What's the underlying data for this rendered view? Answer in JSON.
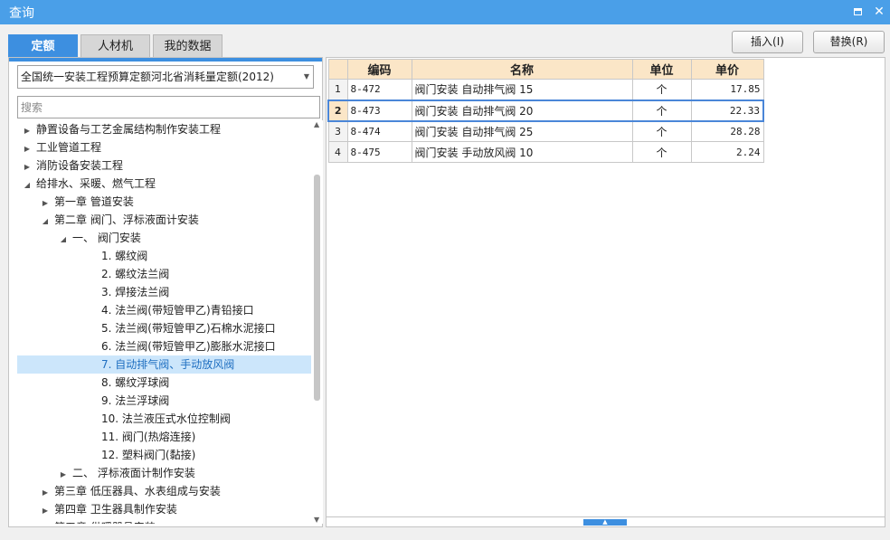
{
  "window": {
    "title": "查询",
    "maximize_icon": "maximize-icon",
    "close_icon": "close-icon",
    "close_glyph": "✕"
  },
  "tabs": [
    {
      "label": "定额",
      "active": true
    },
    {
      "label": "人材机",
      "active": false
    },
    {
      "label": "我的数据",
      "active": false
    }
  ],
  "actions": {
    "insert_label": "插入(I)",
    "replace_label": "替换(R)"
  },
  "quota_select": {
    "value": "全国统一安装工程预算定额河北省消耗量定额(2012)"
  },
  "search": {
    "placeholder": "搜索",
    "value": ""
  },
  "tree": [
    {
      "label": "静置设备与工艺金属结构制作安装工程",
      "level": 0,
      "toggle": "▶",
      "selected": false
    },
    {
      "label": "工业管道工程",
      "level": 0,
      "toggle": "▶",
      "selected": false
    },
    {
      "label": "消防设备安装工程",
      "level": 0,
      "toggle": "▶",
      "selected": false
    },
    {
      "label": "给排水、采暖、燃气工程",
      "level": 0,
      "toggle": "◢",
      "selected": false
    },
    {
      "label": "第一章  管道安装",
      "level": 1,
      "toggle": "▶",
      "selected": false
    },
    {
      "label": "第二章  阀门、浮标液面计安装",
      "level": 1,
      "toggle": "◢",
      "selected": false
    },
    {
      "label": "一、  阀门安装",
      "level": 2,
      "toggle": "◢",
      "selected": false
    },
    {
      "label": "1.  螺纹阀",
      "level": 3,
      "toggle": "",
      "selected": false
    },
    {
      "label": "2.  螺纹法兰阀",
      "level": 3,
      "toggle": "",
      "selected": false
    },
    {
      "label": "3.  焊接法兰阀",
      "level": 3,
      "toggle": "",
      "selected": false
    },
    {
      "label": "4.  法兰阀(带短管甲乙)青铅接口",
      "level": 3,
      "toggle": "",
      "selected": false
    },
    {
      "label": "5.  法兰阀(带短管甲乙)石棉水泥接口",
      "level": 3,
      "toggle": "",
      "selected": false
    },
    {
      "label": "6.  法兰阀(带短管甲乙)膨胀水泥接口",
      "level": 3,
      "toggle": "",
      "selected": false
    },
    {
      "label": "7.  自动排气阀、手动放风阀",
      "level": 3,
      "toggle": "",
      "selected": true
    },
    {
      "label": "8.  螺纹浮球阀",
      "level": 3,
      "toggle": "",
      "selected": false
    },
    {
      "label": "9.  法兰浮球阀",
      "level": 3,
      "toggle": "",
      "selected": false
    },
    {
      "label": "10.  法兰液压式水位控制阀",
      "level": 3,
      "toggle": "",
      "selected": false
    },
    {
      "label": "11.  阀门(热熔连接)",
      "level": 3,
      "toggle": "",
      "selected": false
    },
    {
      "label": "12.  塑料阀门(黏接)",
      "level": 3,
      "toggle": "",
      "selected": false
    },
    {
      "label": "二、  浮标液面计制作安装",
      "level": 2,
      "toggle": "▶",
      "selected": false
    },
    {
      "label": "第三章  低压器具、水表组成与安装",
      "level": 1,
      "toggle": "▶",
      "selected": false
    },
    {
      "label": "第四章  卫生器具制作安装",
      "level": 1,
      "toggle": "▶",
      "selected": false
    },
    {
      "label": "第五章  供暖器具安装",
      "level": 1,
      "toggle": "▶",
      "selected": false
    }
  ],
  "table": {
    "headers": {
      "code": "编码",
      "name": "名称",
      "unit": "单位",
      "price": "单价"
    },
    "rows": [
      {
        "num": "1",
        "code": "8-472",
        "name": "阀门安装 自动排气阀 15",
        "unit": "个",
        "price": "17.85"
      },
      {
        "num": "2",
        "code": "8-473",
        "name": "阀门安装 自动排气阀 20",
        "unit": "个",
        "price": "22.33"
      },
      {
        "num": "3",
        "code": "8-474",
        "name": "阀门安装 自动排气阀 25",
        "unit": "个",
        "price": "28.28"
      },
      {
        "num": "4",
        "code": "8-475",
        "name": "阀门安装 手动放风阀 10",
        "unit": "个",
        "price": "2.24"
      }
    ],
    "selected_row": 1
  },
  "colors": {
    "accent": "#3d8fe0",
    "titlebar": "#4a9fe8",
    "header_bg": "#fbe6c7",
    "selection_bg": "#cce6fb"
  }
}
